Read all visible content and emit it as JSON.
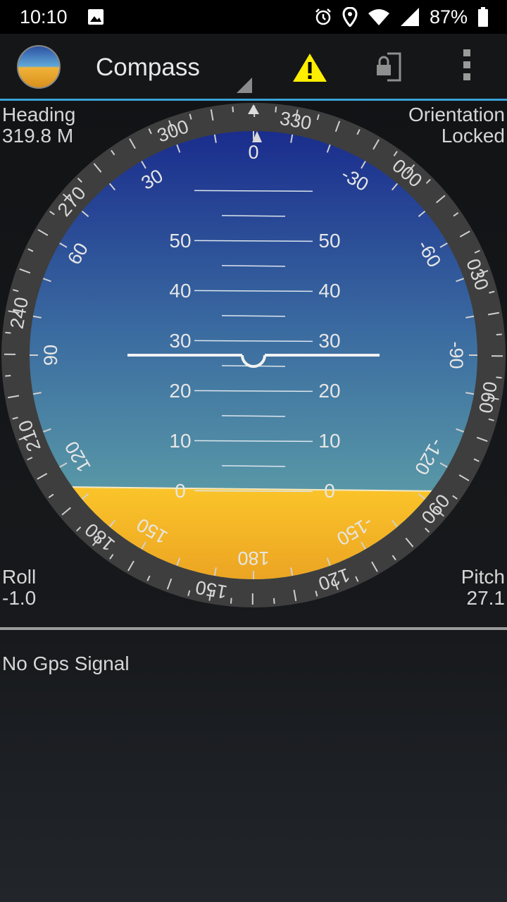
{
  "status_bar": {
    "time": "10:10",
    "battery": "87%"
  },
  "app_bar": {
    "title": "Compass"
  },
  "readouts": {
    "heading_label": "Heading",
    "heading_value": "319.8 M",
    "orientation_label": "Orientation",
    "orientation_value": "Locked",
    "roll_label": "Roll",
    "roll_value": "-1.0",
    "pitch_label": "Pitch",
    "pitch_value": "27.1"
  },
  "dial": {
    "compass_labels": [
      "330",
      "000",
      "030",
      "060",
      "090",
      "120",
      "150",
      "180",
      "210",
      "240",
      "270",
      "300"
    ],
    "roll_labels": [
      "0",
      "-30",
      "-60",
      "-90",
      "-120",
      "-150",
      "180",
      "150",
      "120",
      "90",
      "60",
      "30"
    ],
    "pitch_labels": [
      "50",
      "40",
      "30",
      "20",
      "10",
      "0"
    ]
  },
  "gps": {
    "message": "No Gps Signal"
  },
  "colors": {
    "accent": "#3aa3d8",
    "sky_top": "#1a2a8f",
    "sky_bottom": "#5fa3a8",
    "ground": "#f2b324",
    "bezel": "#3e3e3e"
  }
}
